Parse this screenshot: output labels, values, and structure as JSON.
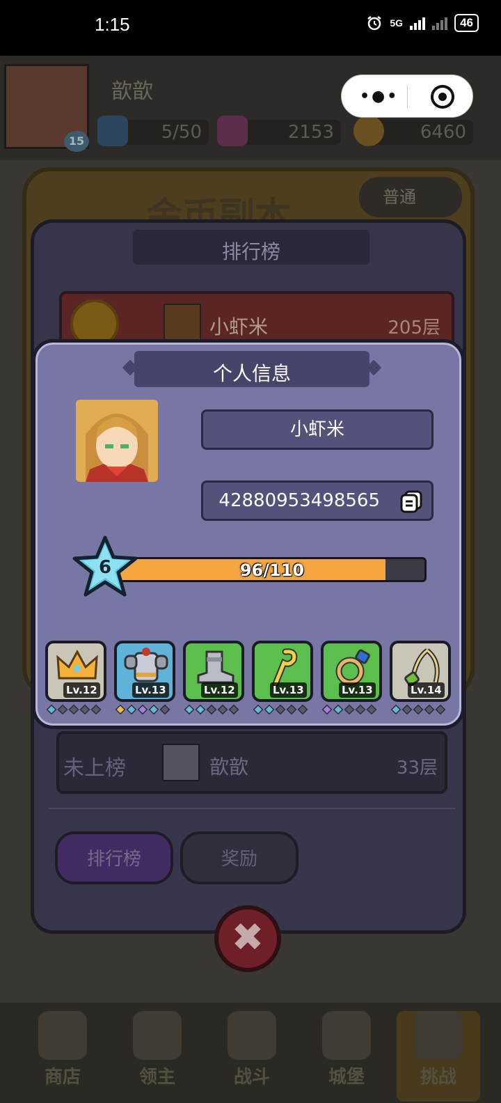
{
  "status_bar": {
    "time": "1:15",
    "network": "5G",
    "battery": "46"
  },
  "background": {
    "player_name": "歆歆",
    "player_level": "15",
    "energy": "5/50",
    "gems": "2153",
    "gold": "6460",
    "difficulty": "普通",
    "dungeon_title": "金币副本",
    "nav": [
      "商店",
      "领主",
      "战斗",
      "城堡",
      "挑战"
    ]
  },
  "ranking": {
    "title": "排行榜",
    "top_entry": {
      "name": "小虾米",
      "score": "205层"
    },
    "my_entry": {
      "status": "未上榜",
      "name": "歆歆",
      "score": "33层"
    },
    "tabs": {
      "rank": "排行榜",
      "reward": "奖励"
    }
  },
  "info": {
    "title": "个人信息",
    "name": "小虾米",
    "id": "42880953498565",
    "level": "6",
    "xp_text": "96/110",
    "xp_fraction": 0.873,
    "equipment": [
      {
        "icon": "crown-icon",
        "level": "Lv.12",
        "bg": "#c9c5b7",
        "gems": [
          "#63b9d6",
          "#5c5a6a",
          "#5c5a6a",
          "#5c5a6a",
          "#5c5a6a"
        ]
      },
      {
        "icon": "armor-icon",
        "level": "Lv.13",
        "bg": "#5fb3d8",
        "gems": [
          "#e5c04a",
          "#63b9d6",
          "#a77de0",
          "#63b9d6",
          "#5c5a6a"
        ]
      },
      {
        "icon": "boot-icon",
        "level": "Lv.12",
        "bg": "#5cbf4d",
        "gems": [
          "#63b9d6",
          "#63b9d6",
          "#5c5a6a",
          "#5c5a6a",
          "#5c5a6a"
        ]
      },
      {
        "icon": "staff-icon",
        "level": "Lv.13",
        "bg": "#5cbf4d",
        "gems": [
          "#63b9d6",
          "#63b9d6",
          "#5c5a6a",
          "#5c5a6a",
          "#5c5a6a"
        ]
      },
      {
        "icon": "ring-icon",
        "level": "Lv.13",
        "bg": "#5cbf4d",
        "gems": [
          "#a77de0",
          "#63b9d6",
          "#5c5a6a",
          "#5c5a6a",
          "#5c5a6a"
        ]
      },
      {
        "icon": "amulet-icon",
        "level": "Lv.14",
        "bg": "#c9c5b7",
        "gems": [
          "#63b9d6",
          "#5c5a6a",
          "#5c5a6a",
          "#5c5a6a",
          "#5c5a6a"
        ]
      }
    ]
  }
}
